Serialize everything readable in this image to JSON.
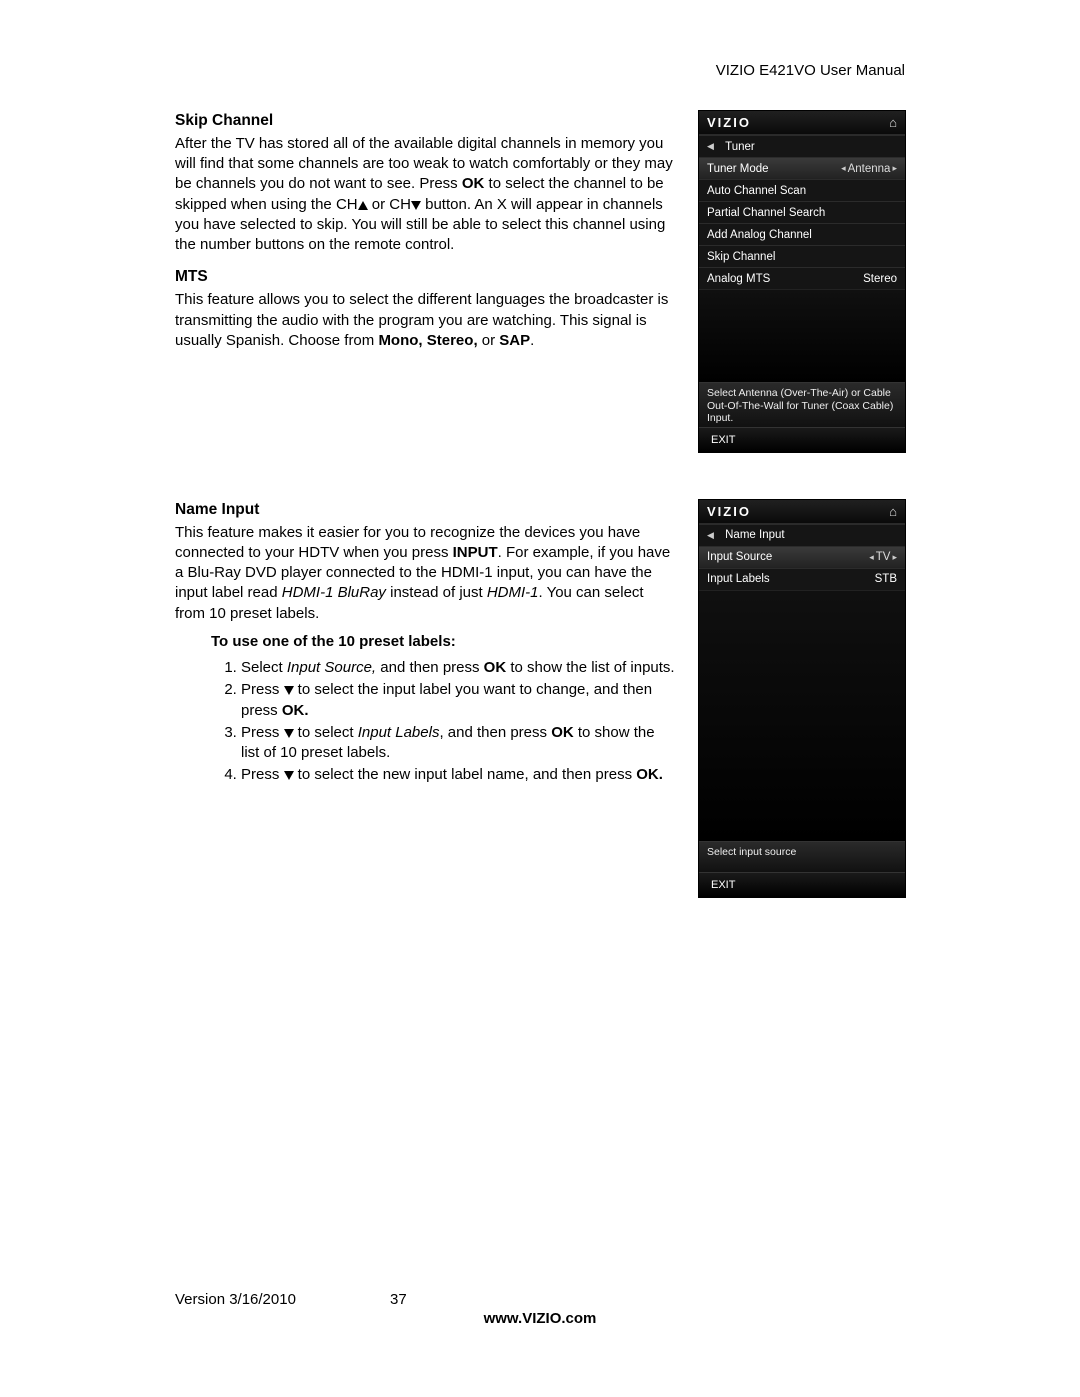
{
  "header": {
    "title": "VIZIO E421VO User Manual"
  },
  "skip": {
    "heading": "Skip Channel",
    "p1a": "After the TV has stored all of the available digital channels in memory you will find that some  channels are too weak to watch comfortably or they may be channels you do not want to see. Press ",
    "p1b_bold": "OK",
    "p1c": " to select the channel to be skipped when using the CH",
    "p1d": " or CH",
    "p1e": " button. An X will appear in channels you have selected to skip. You will still be able to select this channel using the number buttons on the remote control."
  },
  "mts": {
    "heading": "MTS",
    "p1a": "This feature allows you to select the different languages the broadcaster is transmitting the audio with the program you are watching. This signal is usually Spanish. Choose from ",
    "p1b_bold": "Mono, Stereo,",
    "p1c": " or ",
    "p1d_bold": "SAP",
    "p1e": "."
  },
  "name": {
    "heading": "Name Input",
    "p1a": "This feature makes it easier for you to recognize the devices you have connected to your HDTV when  you press ",
    "p1b_bold": "INPUT",
    "p1c": ". For example, if you have a Blu-Ray DVD player connected to the HDMI-1 input, you can have the input label read ",
    "p1d_ital": "HDMI-1 BluRay",
    "p1e": " instead of just ",
    "p1f_ital": "HDMI-1",
    "p1g": ". You can select from 10 preset labels.",
    "sub_bold": "To use one of the 10 preset labels:",
    "steps": {
      "s1a": "Select ",
      "s1b_ital": "Input Source,",
      "s1c": " and then press ",
      "s1d_bold": "OK",
      "s1e": " to show the list of inputs.",
      "s2a": "Press ",
      "s2b": " to select the input label you want to change, and then press ",
      "s2c_bold": "OK.",
      "s3a": "Press ",
      "s3b": " to select ",
      "s3c_ital": "Input Labels",
      "s3d": ", and then press ",
      "s3e_bold": "OK",
      "s3f": " to show the list of 10 preset labels.",
      "s4a": "Press ",
      "s4b": " to select the new input label name, and then press ",
      "s4c_bold": "OK."
    }
  },
  "menu1": {
    "logo": "VIZIO",
    "breadcrumb": "Tuner",
    "rows": {
      "tuner_mode_label": "Tuner Mode",
      "tuner_mode_value": "Antenna",
      "auto_scan": "Auto Channel Scan",
      "partial": "Partial Channel Search",
      "add_analog": "Add Analog Channel",
      "skip": "Skip Channel",
      "mts_label": "Analog MTS",
      "mts_value": "Stereo"
    },
    "hint": "Select Antenna (Over-The-Air) or Cable Out-Of-The-Wall for Tuner (Coax Cable) Input.",
    "exit": "EXIT"
  },
  "menu2": {
    "logo": "VIZIO",
    "breadcrumb": "Name Input",
    "rows": {
      "src_label": "Input Source",
      "src_value": "TV",
      "labels_label": "Input Labels",
      "labels_value": "STB"
    },
    "hint": "Select input source",
    "exit": "EXIT"
  },
  "footer": {
    "version": "Version 3/16/2010",
    "page": "37",
    "url": "www.VIZIO.com"
  }
}
